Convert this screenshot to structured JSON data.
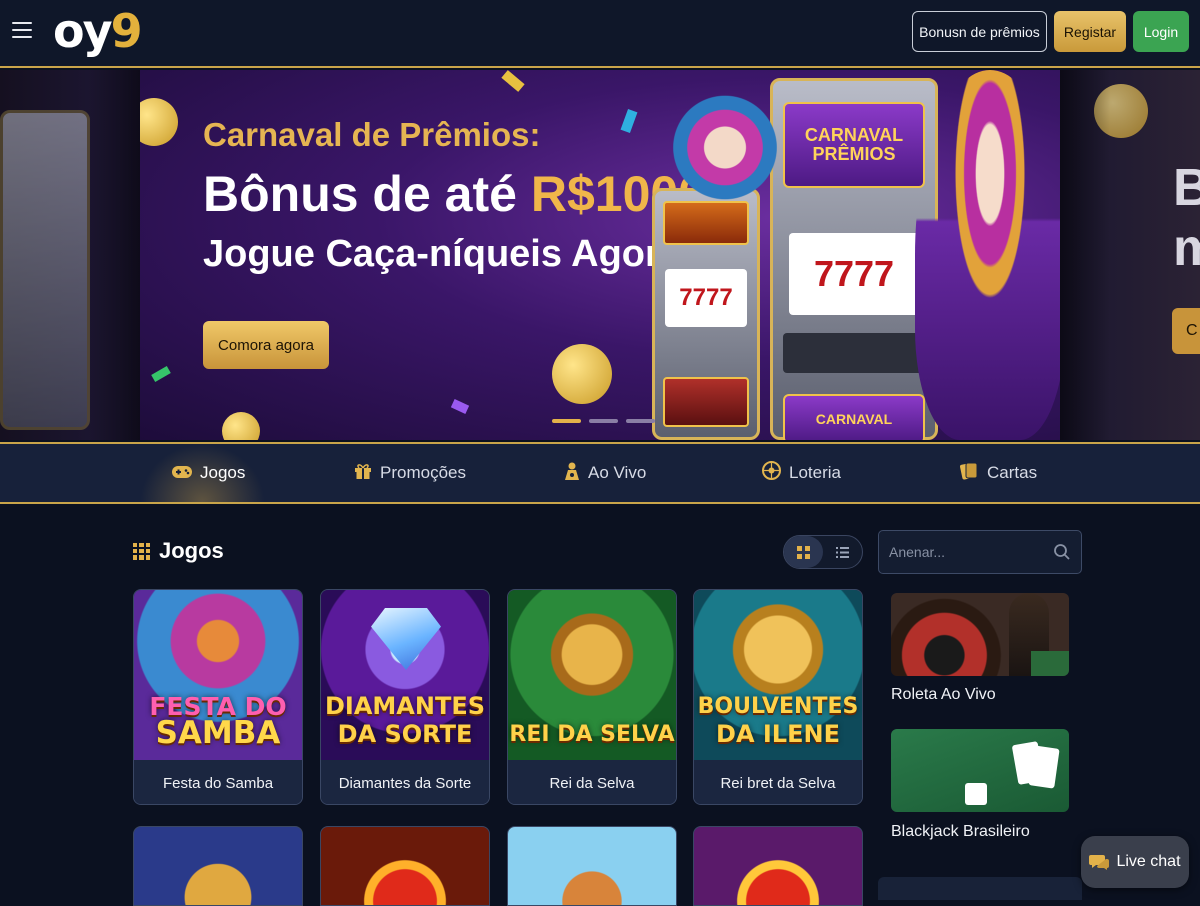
{
  "header": {
    "logo_main": "oy",
    "logo_accent": "9",
    "bonus_button": "Bonusn de prêmios",
    "register_button": "Registar",
    "login_button": "Login"
  },
  "banner": {
    "title_line1": "Carnaval de Prêmios:",
    "title_line2_prefix": "Bônus de até ",
    "title_line2_amount": "R$1000!",
    "title_line3": "Jogue Caça-níqueis Agora!",
    "cta": "Comora agora",
    "slot_marquee_big": "CARNAVAL PRÊMIOS",
    "slot_marquee_small": "CARNAVAL",
    "slot_reels": "7777",
    "side_right_text": "Bo m",
    "side_right_button_letter": "C",
    "dots_active_index": 0
  },
  "nav": {
    "items": [
      {
        "label": "Jogos",
        "icon": "gamepad-icon"
      },
      {
        "label": "Promoções",
        "icon": "gift-icon"
      },
      {
        "label": "Ao Vivo",
        "icon": "live-dealer-icon"
      },
      {
        "label": "Loteria",
        "icon": "lottery-ball-icon"
      },
      {
        "label": "Cartas",
        "icon": "cards-icon"
      }
    ]
  },
  "games": {
    "title": "Jogos",
    "view_mode": "grid",
    "cards": [
      {
        "art_line1": "FESTA DO",
        "art_line2": "SAMBA",
        "label": "Festa do Samba"
      },
      {
        "art_line1": "DIAMANTES",
        "art_line2": "DA SORTE",
        "label": "Diamantes da Sorte"
      },
      {
        "art_line1": "REI DA SELVA",
        "art_line2": "",
        "label": "Rei da Selva"
      },
      {
        "art_line1": "BOULVENTES",
        "art_line2": "DA ILENE",
        "label": "Rei bret da Selva"
      }
    ]
  },
  "sidebar": {
    "search_placeholder": "Anenar...",
    "live_games": [
      {
        "label": "Roleta Ao Vivo"
      },
      {
        "label": "Blackjack Brasileiro"
      }
    ]
  },
  "livechat": {
    "label": "Live chat"
  },
  "colors": {
    "accent_gold": "#e3b24a",
    "login_green": "#3ba452",
    "background": "#0b1120"
  }
}
